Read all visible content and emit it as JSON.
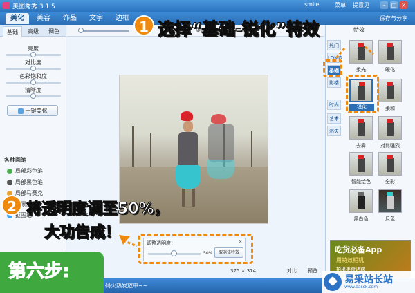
{
  "window": {
    "title": "美图秀秀 3.1.5",
    "user": "smile",
    "menu": [
      "菜单",
      "提意见"
    ]
  },
  "toolbar": {
    "tabs": [
      "美化",
      "美容",
      "饰品",
      "文字",
      "边框"
    ],
    "save_label": "保存与分享"
  },
  "left": {
    "subtabs": [
      "基础",
      "高级",
      "调色"
    ],
    "sliders": [
      {
        "label": "亮度",
        "level": 0.5
      },
      {
        "label": "对比度",
        "level": 0.5
      },
      {
        "label": "色彩饱和度",
        "level": 0.5
      },
      {
        "label": "清晰度",
        "level": 0.5
      }
    ],
    "onekey_label": "一键美化",
    "brush_header": "各种画笔",
    "brushes": [
      "局部彩色笔",
      "局部黑色笔",
      "局部马赛克",
      "背景虚化",
      "抠图笔"
    ]
  },
  "canvas": {
    "tools": [
      "旋转",
      "尺寸"
    ],
    "opacity": {
      "title": "调整透明度：",
      "value": "50%",
      "level": 0.5,
      "cancel": "取消该特效"
    },
    "dims": [
      "375",
      "374"
    ],
    "footer": [
      "对比",
      "预览"
    ]
  },
  "right": {
    "header": "特效",
    "categories": [
      "热门",
      "LOMO",
      "基础",
      "影楼",
      "时尚",
      "艺术",
      "溅失"
    ],
    "effects": [
      "柔光",
      "暖化",
      "锐化",
      "柔和",
      "去雾",
      "对比强烈",
      "智能绘色",
      "全彩",
      "黑白色",
      "反色"
    ],
    "ad": {
      "title": "吃货必备App",
      "line1": "用特效相机",
      "line2": "拍出美食诱惑"
    }
  },
  "status": {
    "text": "码火热发放中~~"
  },
  "overlay": {
    "step1": "选择“基础-锐化”特效",
    "step1_num": "1",
    "step2_line1": "将透明度调至50%，",
    "step2_line2": "大功告成！",
    "step2_num": "2",
    "step_badge": "第六步:",
    "accent": "#f08a0e"
  },
  "watermark": {
    "title": "易采站长站",
    "url": "www.easck.com"
  }
}
